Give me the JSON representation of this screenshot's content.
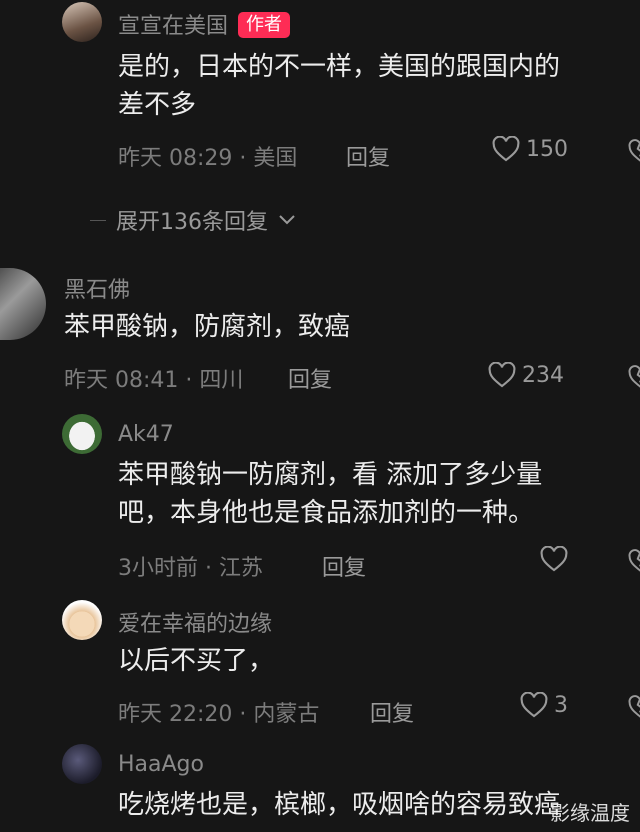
{
  "comments": [
    {
      "username": "宣宣在美国",
      "badge": "作者",
      "text_lines": [
        "是的，日本的不一样，美国的跟国内的",
        "差不多"
      ],
      "meta": "昨天 08:29 · 美国",
      "reply_label": "回复",
      "likes": "150",
      "expand_label": "展开136条回复"
    },
    {
      "username": "黑石佛",
      "text_lines": [
        "苯甲酸钠，防腐剂，致癌"
      ],
      "meta": "昨天 08:41 · 四川",
      "reply_label": "回复",
      "likes": "234"
    },
    {
      "username": "Ak47",
      "text_lines": [
        "苯甲酸钠一防腐剂，看 添加了多少量",
        "吧，本身他也是食品添加剂的一种。"
      ],
      "meta": "3小时前 · 江苏",
      "reply_label": "回复",
      "likes": ""
    },
    {
      "username": "爱在幸福的边缘",
      "text_lines": [
        "以后不买了，"
      ],
      "meta": "昨天 22:20 · 内蒙古",
      "reply_label": "回复",
      "likes": "3"
    },
    {
      "username": "HaaAgo",
      "text_lines": [
        "吃烧烤也是，槟榔，吸烟啥的容易致癌"
      ]
    }
  ],
  "watermark": "影缘温度",
  "colors": {
    "background": "#161616",
    "badge": "#fe2c55",
    "muted": "#7c7c7c"
  }
}
